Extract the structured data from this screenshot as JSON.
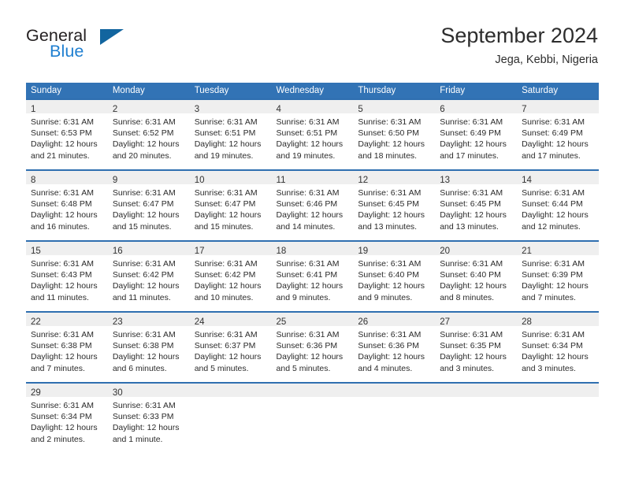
{
  "logo": {
    "word_top": "General",
    "word_bottom": "Blue",
    "triangle": "triangle-icon",
    "colors": {
      "dark": "#231f20",
      "blue": "#1f7fd0",
      "triangle": "#12659f"
    }
  },
  "header": {
    "title": "September 2024",
    "subtitle": "Jega, Kebbi, Nigeria"
  },
  "theme": {
    "header_blue": "#3273b5",
    "row_border_blue": "#2f6fb0",
    "day_head_gray": "#efefef"
  },
  "weekdays": [
    "Sunday",
    "Monday",
    "Tuesday",
    "Wednesday",
    "Thursday",
    "Friday",
    "Saturday"
  ],
  "weeks": [
    [
      {
        "day": "1",
        "sunrise": "Sunrise: 6:31 AM",
        "sunset": "Sunset: 6:53 PM",
        "daylight1": "Daylight: 12 hours",
        "daylight2": "and 21 minutes."
      },
      {
        "day": "2",
        "sunrise": "Sunrise: 6:31 AM",
        "sunset": "Sunset: 6:52 PM",
        "daylight1": "Daylight: 12 hours",
        "daylight2": "and 20 minutes."
      },
      {
        "day": "3",
        "sunrise": "Sunrise: 6:31 AM",
        "sunset": "Sunset: 6:51 PM",
        "daylight1": "Daylight: 12 hours",
        "daylight2": "and 19 minutes."
      },
      {
        "day": "4",
        "sunrise": "Sunrise: 6:31 AM",
        "sunset": "Sunset: 6:51 PM",
        "daylight1": "Daylight: 12 hours",
        "daylight2": "and 19 minutes."
      },
      {
        "day": "5",
        "sunrise": "Sunrise: 6:31 AM",
        "sunset": "Sunset: 6:50 PM",
        "daylight1": "Daylight: 12 hours",
        "daylight2": "and 18 minutes."
      },
      {
        "day": "6",
        "sunrise": "Sunrise: 6:31 AM",
        "sunset": "Sunset: 6:49 PM",
        "daylight1": "Daylight: 12 hours",
        "daylight2": "and 17 minutes."
      },
      {
        "day": "7",
        "sunrise": "Sunrise: 6:31 AM",
        "sunset": "Sunset: 6:49 PM",
        "daylight1": "Daylight: 12 hours",
        "daylight2": "and 17 minutes."
      }
    ],
    [
      {
        "day": "8",
        "sunrise": "Sunrise: 6:31 AM",
        "sunset": "Sunset: 6:48 PM",
        "daylight1": "Daylight: 12 hours",
        "daylight2": "and 16 minutes."
      },
      {
        "day": "9",
        "sunrise": "Sunrise: 6:31 AM",
        "sunset": "Sunset: 6:47 PM",
        "daylight1": "Daylight: 12 hours",
        "daylight2": "and 15 minutes."
      },
      {
        "day": "10",
        "sunrise": "Sunrise: 6:31 AM",
        "sunset": "Sunset: 6:47 PM",
        "daylight1": "Daylight: 12 hours",
        "daylight2": "and 15 minutes."
      },
      {
        "day": "11",
        "sunrise": "Sunrise: 6:31 AM",
        "sunset": "Sunset: 6:46 PM",
        "daylight1": "Daylight: 12 hours",
        "daylight2": "and 14 minutes."
      },
      {
        "day": "12",
        "sunrise": "Sunrise: 6:31 AM",
        "sunset": "Sunset: 6:45 PM",
        "daylight1": "Daylight: 12 hours",
        "daylight2": "and 13 minutes."
      },
      {
        "day": "13",
        "sunrise": "Sunrise: 6:31 AM",
        "sunset": "Sunset: 6:45 PM",
        "daylight1": "Daylight: 12 hours",
        "daylight2": "and 13 minutes."
      },
      {
        "day": "14",
        "sunrise": "Sunrise: 6:31 AM",
        "sunset": "Sunset: 6:44 PM",
        "daylight1": "Daylight: 12 hours",
        "daylight2": "and 12 minutes."
      }
    ],
    [
      {
        "day": "15",
        "sunrise": "Sunrise: 6:31 AM",
        "sunset": "Sunset: 6:43 PM",
        "daylight1": "Daylight: 12 hours",
        "daylight2": "and 11 minutes."
      },
      {
        "day": "16",
        "sunrise": "Sunrise: 6:31 AM",
        "sunset": "Sunset: 6:42 PM",
        "daylight1": "Daylight: 12 hours",
        "daylight2": "and 11 minutes."
      },
      {
        "day": "17",
        "sunrise": "Sunrise: 6:31 AM",
        "sunset": "Sunset: 6:42 PM",
        "daylight1": "Daylight: 12 hours",
        "daylight2": "and 10 minutes."
      },
      {
        "day": "18",
        "sunrise": "Sunrise: 6:31 AM",
        "sunset": "Sunset: 6:41 PM",
        "daylight1": "Daylight: 12 hours",
        "daylight2": "and 9 minutes."
      },
      {
        "day": "19",
        "sunrise": "Sunrise: 6:31 AM",
        "sunset": "Sunset: 6:40 PM",
        "daylight1": "Daylight: 12 hours",
        "daylight2": "and 9 minutes."
      },
      {
        "day": "20",
        "sunrise": "Sunrise: 6:31 AM",
        "sunset": "Sunset: 6:40 PM",
        "daylight1": "Daylight: 12 hours",
        "daylight2": "and 8 minutes."
      },
      {
        "day": "21",
        "sunrise": "Sunrise: 6:31 AM",
        "sunset": "Sunset: 6:39 PM",
        "daylight1": "Daylight: 12 hours",
        "daylight2": "and 7 minutes."
      }
    ],
    [
      {
        "day": "22",
        "sunrise": "Sunrise: 6:31 AM",
        "sunset": "Sunset: 6:38 PM",
        "daylight1": "Daylight: 12 hours",
        "daylight2": "and 7 minutes."
      },
      {
        "day": "23",
        "sunrise": "Sunrise: 6:31 AM",
        "sunset": "Sunset: 6:38 PM",
        "daylight1": "Daylight: 12 hours",
        "daylight2": "and 6 minutes."
      },
      {
        "day": "24",
        "sunrise": "Sunrise: 6:31 AM",
        "sunset": "Sunset: 6:37 PM",
        "daylight1": "Daylight: 12 hours",
        "daylight2": "and 5 minutes."
      },
      {
        "day": "25",
        "sunrise": "Sunrise: 6:31 AM",
        "sunset": "Sunset: 6:36 PM",
        "daylight1": "Daylight: 12 hours",
        "daylight2": "and 5 minutes."
      },
      {
        "day": "26",
        "sunrise": "Sunrise: 6:31 AM",
        "sunset": "Sunset: 6:36 PM",
        "daylight1": "Daylight: 12 hours",
        "daylight2": "and 4 minutes."
      },
      {
        "day": "27",
        "sunrise": "Sunrise: 6:31 AM",
        "sunset": "Sunset: 6:35 PM",
        "daylight1": "Daylight: 12 hours",
        "daylight2": "and 3 minutes."
      },
      {
        "day": "28",
        "sunrise": "Sunrise: 6:31 AM",
        "sunset": "Sunset: 6:34 PM",
        "daylight1": "Daylight: 12 hours",
        "daylight2": "and 3 minutes."
      }
    ],
    [
      {
        "day": "29",
        "sunrise": "Sunrise: 6:31 AM",
        "sunset": "Sunset: 6:34 PM",
        "daylight1": "Daylight: 12 hours",
        "daylight2": "and 2 minutes."
      },
      {
        "day": "30",
        "sunrise": "Sunrise: 6:31 AM",
        "sunset": "Sunset: 6:33 PM",
        "daylight1": "Daylight: 12 hours",
        "daylight2": "and 1 minute."
      },
      {
        "day": "",
        "sunrise": "",
        "sunset": "",
        "daylight1": "",
        "daylight2": ""
      },
      {
        "day": "",
        "sunrise": "",
        "sunset": "",
        "daylight1": "",
        "daylight2": ""
      },
      {
        "day": "",
        "sunrise": "",
        "sunset": "",
        "daylight1": "",
        "daylight2": ""
      },
      {
        "day": "",
        "sunrise": "",
        "sunset": "",
        "daylight1": "",
        "daylight2": ""
      },
      {
        "day": "",
        "sunrise": "",
        "sunset": "",
        "daylight1": "",
        "daylight2": ""
      }
    ]
  ]
}
